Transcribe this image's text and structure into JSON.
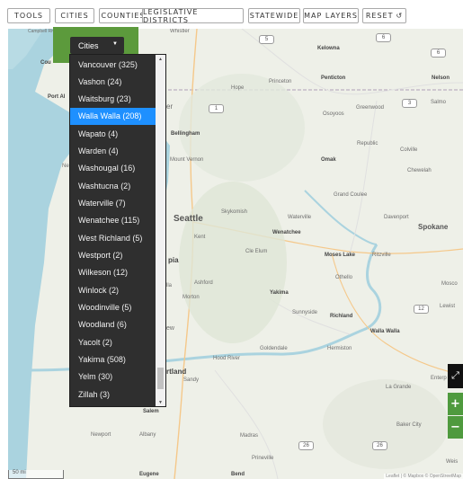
{
  "toolbar": {
    "buttons": [
      "TOOLS",
      "CITIES",
      "COUNTIES",
      "LEGISLATIVE DISTRICTS",
      "STATEWIDE",
      "MAP LAYERS",
      "RESET"
    ],
    "reset_icon": "undo-icon"
  },
  "selector": {
    "label": "Cities",
    "caret_icon": "caret-down-icon"
  },
  "dropdown": {
    "items": [
      "Vancouver (325)",
      "Vashon (24)",
      "Waitsburg (23)",
      "Walla Walla (208)",
      "Wapato (4)",
      "Warden (4)",
      "Washougal (16)",
      "Washtucna (2)",
      "Waterville (7)",
      "Wenatchee (115)",
      "West Richland (5)",
      "Westport (2)",
      "Wilkeson (12)",
      "Winlock (2)",
      "Woodinville (5)",
      "Woodland (6)",
      "Yacolt (2)",
      "Yakima (508)",
      "Yelm (30)",
      "Zillah (3)"
    ],
    "selected": "Walla Walla (208)"
  },
  "map": {
    "places": {
      "campbell_river": "Campbell River",
      "whistler": "Whistler",
      "kelowna": "Kelowna",
      "princeton": "Princeton",
      "penticton": "Penticton",
      "nelson": "Nelson",
      "hope": "Hope",
      "port_al": "Port Al",
      "osoyoos": "Osoyoos",
      "greenwood": "Greenwood",
      "salmo": "Salmo",
      "bellingham": "Bellingham",
      "republic": "Republic",
      "colville": "Colville",
      "mount_vernon": "Mount Vernon",
      "omak": "Omak",
      "chewelah": "Chewelah",
      "grand_coulee": "Grand Coulee",
      "seattle": "Seattle",
      "skykomish": "Skykomish",
      "waterville": "Waterville",
      "davenport": "Davenport",
      "spokane": "Spokane",
      "kent": "Kent",
      "wenatchee": "Wenatchee",
      "cle_elum": "Cle Elum",
      "moses_lake": "Moses Lake",
      "ritzville": "Ritzville",
      "othello": "Othello",
      "ashford": "Ashford",
      "morton": "Morton",
      "yakima": "Yakima",
      "mosco": "Mosco",
      "lewist": "Lewist",
      "sunnyside": "Sunnyside",
      "richland": "Richland",
      "walla_walla": "Walla Walla",
      "goldendale": "Goldendale",
      "hermiston": "Hermiston",
      "hood_river": "Hood River",
      "sandy": "Sandy",
      "la_grande": "La Grande",
      "enterp": "Enterp",
      "salem": "Salem",
      "newport": "Newport",
      "albany": "Albany",
      "madras": "Madras",
      "baker_city": "Baker City",
      "prineville": "Prineville",
      "eugene": "Eugene",
      "bend": "Bend",
      "weis": "Weis",
      "frag_rtland": "rtland",
      "frag_pia": "pia",
      "frag_lla": "lla",
      "frag_ew": "ew",
      "frag_ne": "Ne",
      "frag_er": "er",
      "frag_cou": "Cou"
    },
    "shields": [
      "5",
      "6",
      "6",
      "3",
      "1",
      "12",
      "26",
      "26"
    ],
    "scale_label": "50 mi",
    "attribution": "Leaflet | © Mapbox © OpenStreetMap"
  },
  "zoom": {
    "expand_icon": "expand-icon",
    "plus": "+",
    "minus": "−"
  },
  "colors": {
    "accent_green": "#5c9a3c",
    "selected_blue": "#1e90ff",
    "dropdown_bg": "#2f2f2f"
  }
}
